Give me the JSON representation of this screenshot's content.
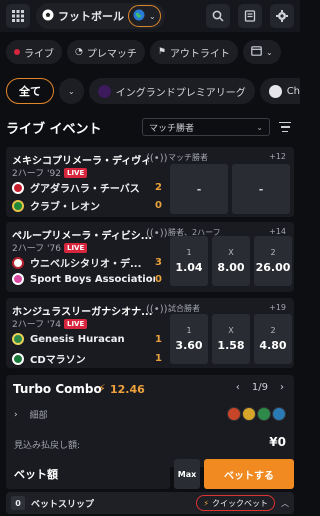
{
  "topbar": {
    "sport_name": "フットボール"
  },
  "filters": {
    "live": "ライブ",
    "prematch": "プレマッチ",
    "outright": "アウトライト"
  },
  "leagues": {
    "all": "全て",
    "premier": "イングランドプレミアリーグ",
    "next": "Champio"
  },
  "section": {
    "title": "ライブ イベント",
    "market_select": "マッチ勝者"
  },
  "matches": [
    {
      "league": "メキシコプリメーラ・ディヴィ...",
      "period": "2ハーフ '92",
      "live": "LIVE",
      "market": "マッチ勝者",
      "count": "+12",
      "team1": "グアダラハラ・チーバス",
      "score1": "2",
      "team2": "クラブ・レオン",
      "score2": "0",
      "odds": [
        {
          "label": "",
          "value": "-"
        },
        {
          "label": "",
          "value": "-"
        }
      ]
    },
    {
      "league": "ペループリメーラ・ディビシ...",
      "period": "2ハーフ '76",
      "live": "LIVE",
      "market": "勝者、2ハーフ",
      "count": "+14",
      "team1": "ウニベルシタリオ・デ...",
      "score1": "3",
      "team2": "Sport Boys Association",
      "score2": "0",
      "odds": [
        {
          "label": "1",
          "value": "1.04"
        },
        {
          "label": "X",
          "value": "8.00"
        },
        {
          "label": "2",
          "value": "26.00"
        }
      ]
    },
    {
      "league": "ホンジュラスリーガナシオナ...",
      "period": "2ハーフ '74",
      "live": "LIVE",
      "market": "試合勝者",
      "count": "+19",
      "team1": "Genesis Huracan",
      "score1": "1",
      "team2": "CDマラソン",
      "score2": "1",
      "odds": [
        {
          "label": "1",
          "value": "3.60"
        },
        {
          "label": "X",
          "value": "1.58"
        },
        {
          "label": "2",
          "value": "4.80"
        }
      ]
    }
  ],
  "combo": {
    "title": "Turbo Combo",
    "value": "12.46",
    "page": "1/9",
    "detail": "細部",
    "payout_label": "見込み払戻し額:",
    "payout_value": "¥0"
  },
  "bet": {
    "stake_label": "ベット額",
    "max_label": "Max",
    "place_label": "ベットする"
  },
  "betslip": {
    "count": "0",
    "label": "ベットスリップ",
    "quick_label": "クイックベット"
  },
  "colors": {
    "accent": "#f08a21",
    "live": "#d7263d",
    "background": "#0d0e12"
  }
}
